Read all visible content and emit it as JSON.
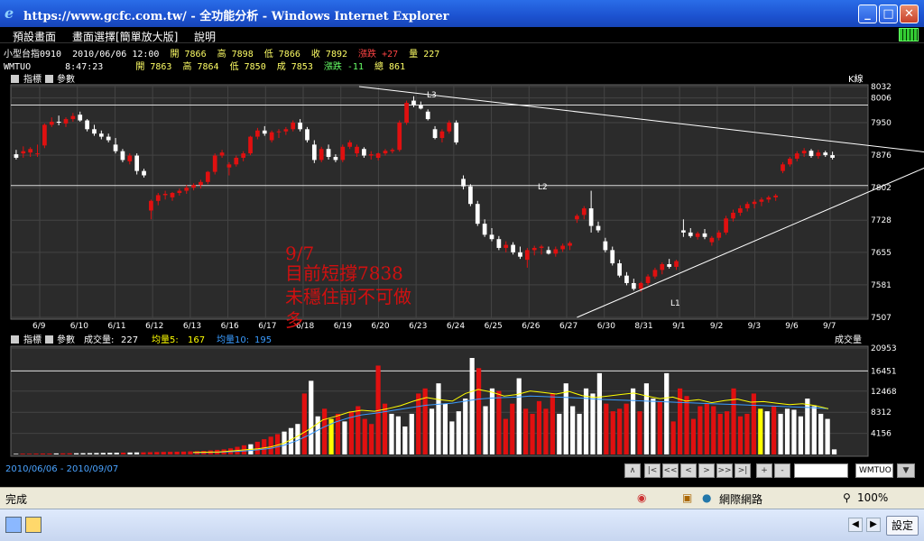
{
  "window": {
    "title": "https://www.gcfc.com.tw/ - 全功能分析 - Windows Internet Explorer",
    "buttons": [
      "_",
      "□",
      "✕"
    ]
  },
  "menu": {
    "items": [
      "預設畫面",
      "畫面選擇[簡單放大版]",
      "說明"
    ]
  },
  "quotes": {
    "row1": [
      "小型台指0910",
      "2010/06/06 12:00",
      "開 7866",
      "高 7898",
      "低 7866",
      "收 7892",
      "漲跌 +27",
      "量 227"
    ],
    "row2": [
      "WMTUO",
      "8:47:23",
      "開 7863",
      "高 7864",
      "低 7850",
      "成 7853",
      "漲跌 -11",
      "總 861"
    ]
  },
  "price_panel": {
    "indicator_label": "指標",
    "param_label": "參數",
    "kline_label": "K線",
    "y_ticks": [
      "8032",
      "8006",
      "7950",
      "7876",
      "7802",
      "7728",
      "7655",
      "7581",
      "7507"
    ],
    "x_ticks": [
      "6/9",
      "6/10",
      "6/11",
      "6/12",
      "6/13",
      "6/16",
      "6/17",
      "6/18",
      "6/19",
      "6/20",
      "6/23",
      "6/24",
      "6/25",
      "6/26",
      "6/27",
      "6/30",
      "8/31",
      "9/1",
      "9/2",
      "9/3",
      "9/6",
      "9/7"
    ],
    "marks": {
      "l1": "L1",
      "l2": "L2",
      "l3": "L3"
    },
    "annotation": {
      "line1": "9/7",
      "line2": "目前短撐7838",
      "line3": "未穩住前不可做",
      "line4": "多"
    }
  },
  "volume_panel": {
    "indicator_label": "指標",
    "param_label": "參數",
    "vol_label": "成交量:",
    "vol_value": "227",
    "ma5_label": "均量5:",
    "ma5_value": "167",
    "ma10_label": "均量10:",
    "ma10_value": "195",
    "right_label": "成交量",
    "y_ticks": [
      "20953",
      "16451",
      "12468",
      "8312",
      "4156"
    ]
  },
  "app_status": {
    "date_range": "2010/06/06 - 2010/09/07",
    "nav": [
      "∧",
      "|<",
      "<<",
      "<",
      ">",
      ">>",
      ">|",
      "+",
      "-"
    ],
    "symbol": "WMTUO"
  },
  "ie_status": {
    "done": "完成",
    "zone": "網際網路",
    "zoom": "100%"
  },
  "taskbar": {
    "settings": "設定"
  },
  "colors": {
    "up": "#e01010",
    "down": "#ffffff",
    "ma5": "#ffff00",
    "ma10": "#3a9bff",
    "panel_bg": "#2b2b2b"
  },
  "chart_data": {
    "type": "candlestick",
    "ylim": [
      7507,
      8032
    ],
    "candles": [
      [
        7878,
        7888,
        7866,
        7870
      ],
      [
        7880,
        7896,
        7870,
        7885
      ],
      [
        7882,
        7894,
        7872,
        7890
      ],
      [
        7878,
        7900,
        7872,
        7880
      ],
      [
        7898,
        7948,
        7892,
        7945
      ],
      [
        7945,
        7962,
        7940,
        7952
      ],
      [
        7952,
        7966,
        7944,
        7950
      ],
      [
        7948,
        7962,
        7940,
        7958
      ],
      [
        7958,
        7972,
        7952,
        7965
      ],
      [
        7968,
        7975,
        7952,
        7955
      ],
      [
        7955,
        7958,
        7930,
        7935
      ],
      [
        7935,
        7945,
        7920,
        7925
      ],
      [
        7925,
        7932,
        7912,
        7918
      ],
      [
        7918,
        7925,
        7905,
        7910
      ],
      [
        7900,
        7915,
        7880,
        7885
      ],
      [
        7885,
        7890,
        7860,
        7865
      ],
      [
        7862,
        7880,
        7855,
        7875
      ],
      [
        7875,
        7880,
        7832,
        7840
      ],
      [
        7840,
        7845,
        7825,
        7830
      ],
      [
        7750,
        7775,
        7730,
        7772
      ],
      [
        7772,
        7790,
        7762,
        7785
      ],
      [
        7785,
        7795,
        7775,
        7788
      ],
      [
        7780,
        7792,
        7772,
        7790
      ],
      [
        7790,
        7800,
        7784,
        7795
      ],
      [
        7795,
        7808,
        7788,
        7802
      ],
      [
        7802,
        7812,
        7796,
        7808
      ],
      [
        7808,
        7820,
        7800,
        7815
      ],
      [
        7815,
        7840,
        7810,
        7838
      ],
      [
        7838,
        7880,
        7832,
        7875
      ],
      [
        7875,
        7888,
        7870,
        7882
      ],
      [
        7848,
        7860,
        7830,
        7855
      ],
      [
        7855,
        7875,
        7850,
        7870
      ],
      [
        7870,
        7885,
        7862,
        7880
      ],
      [
        7880,
        7920,
        7876,
        7918
      ],
      [
        7918,
        7938,
        7912,
        7932
      ],
      [
        7932,
        7942,
        7920,
        7925
      ],
      [
        7910,
        7932,
        7905,
        7928
      ],
      [
        7928,
        7935,
        7915,
        7930
      ],
      [
        7930,
        7940,
        7922,
        7935
      ],
      [
        7935,
        7955,
        7930,
        7950
      ],
      [
        7950,
        7958,
        7930,
        7935
      ],
      [
        7935,
        7940,
        7905,
        7910
      ],
      [
        7900,
        7910,
        7858,
        7865
      ],
      [
        7865,
        7895,
        7860,
        7890
      ],
      [
        7890,
        7900,
        7866,
        7872
      ],
      [
        7872,
        7878,
        7860,
        7865
      ],
      [
        7865,
        7900,
        7860,
        7895
      ],
      [
        7895,
        7910,
        7890,
        7905
      ],
      [
        7880,
        7900,
        7872,
        7895
      ],
      [
        7890,
        7894,
        7870,
        7875
      ],
      [
        7875,
        7885,
        7866,
        7878
      ],
      [
        7870,
        7882,
        7864,
        7880
      ],
      [
        7880,
        7890,
        7875,
        7886
      ],
      [
        7885,
        7892,
        7880,
        7888
      ],
      [
        7888,
        7955,
        7884,
        7950
      ],
      [
        7950,
        8000,
        7945,
        7995
      ],
      [
        8000,
        8010,
        7985,
        7990
      ],
      [
        7990,
        7998,
        7980,
        7982
      ],
      [
        7975,
        7980,
        7955,
        7958
      ],
      [
        7935,
        7942,
        7912,
        7915
      ],
      [
        7915,
        7935,
        7905,
        7930
      ],
      [
        7930,
        7955,
        7925,
        7950
      ],
      [
        7950,
        7955,
        7900,
        7905
      ],
      [
        7822,
        7830,
        7798,
        7805
      ],
      [
        7805,
        7810,
        7760,
        7765
      ],
      [
        7765,
        7772,
        7715,
        7720
      ],
      [
        7720,
        7730,
        7690,
        7695
      ],
      [
        7695,
        7710,
        7680,
        7685
      ],
      [
        7685,
        7692,
        7660,
        7665
      ],
      [
        7665,
        7680,
        7655,
        7672
      ],
      [
        7672,
        7678,
        7650,
        7655
      ],
      [
        7655,
        7668,
        7640,
        7645
      ],
      [
        7638,
        7665,
        7620,
        7660
      ],
      [
        7660,
        7670,
        7648,
        7665
      ],
      [
        7665,
        7672,
        7650,
        7668
      ],
      [
        7660,
        7668,
        7650,
        7652
      ],
      [
        7652,
        7668,
        7645,
        7662
      ],
      [
        7662,
        7675,
        7656,
        7670
      ],
      [
        7670,
        7680,
        7660,
        7676
      ],
      [
        7730,
        7742,
        7722,
        7738
      ],
      [
        7740,
        7760,
        7730,
        7755
      ],
      [
        7755,
        7795,
        7700,
        7715
      ],
      [
        7715,
        7725,
        7700,
        7705
      ],
      [
        7680,
        7688,
        7655,
        7660
      ],
      [
        7660,
        7668,
        7625,
        7630
      ],
      [
        7630,
        7638,
        7598,
        7602
      ],
      [
        7602,
        7610,
        7580,
        7585
      ],
      [
        7585,
        7595,
        7568,
        7572
      ],
      [
        7572,
        7588,
        7565,
        7585
      ],
      [
        7585,
        7605,
        7580,
        7600
      ],
      [
        7600,
        7620,
        7595,
        7615
      ],
      [
        7615,
        7632,
        7605,
        7628
      ],
      [
        7628,
        7640,
        7618,
        7622
      ],
      [
        7622,
        7638,
        7615,
        7635
      ],
      [
        7705,
        7730,
        7690,
        7700
      ],
      [
        7700,
        7710,
        7688,
        7692
      ],
      [
        7690,
        7702,
        7684,
        7698
      ],
      [
        7698,
        7708,
        7685,
        7690
      ],
      [
        7678,
        7692,
        7670,
        7688
      ],
      [
        7688,
        7705,
        7682,
        7700
      ],
      [
        7700,
        7738,
        7695,
        7732
      ],
      [
        7732,
        7752,
        7725,
        7745
      ],
      [
        7745,
        7762,
        7738,
        7755
      ],
      [
        7755,
        7770,
        7748,
        7765
      ],
      [
        7765,
        7775,
        7755,
        7770
      ],
      [
        7770,
        7780,
        7760,
        7775
      ],
      [
        7775,
        7784,
        7768,
        7780
      ],
      [
        7780,
        7788,
        7772,
        7784
      ],
      [
        7840,
        7860,
        7835,
        7855
      ],
      [
        7855,
        7872,
        7850,
        7868
      ],
      [
        7868,
        7885,
        7862,
        7880
      ],
      [
        7880,
        7892,
        7872,
        7886
      ],
      [
        7886,
        7890,
        7870,
        7874
      ],
      [
        7874,
        7888,
        7868,
        7882
      ],
      [
        7882,
        7886,
        7872,
        7876
      ],
      [
        7876,
        7884,
        7866,
        7870
      ]
    ],
    "trendlines": [
      {
        "from": [
          0,
          8032
        ],
        "to": [
          134,
          7872
        ]
      },
      {
        "from": [
          79,
          7507
        ],
        "to": [
          134,
          7889
        ]
      }
    ],
    "hlines": [
      7990,
      7807
    ],
    "volume": {
      "ylim": [
        0,
        20953
      ],
      "values": [
        120,
        150,
        140,
        160,
        180,
        170,
        200,
        210,
        220,
        230,
        250,
        260,
        280,
        300,
        320,
        340,
        360,
        380,
        400,
        420,
        450,
        480,
        500,
        520,
        540,
        560,
        600,
        650,
        700,
        800,
        900,
        1000,
        1200,
        1500,
        1800,
        2000,
        2500,
        3000,
        3500,
        4000,
        4500,
        5200,
        6000,
        12000,
        14500,
        7500,
        9000,
        7000,
        8000,
        6500,
        8500,
        9500,
        7000,
        6000,
        17500,
        10000,
        8000,
        7500,
        5500,
        8000,
        12000,
        13000,
        9000,
        14000,
        10000,
        6500,
        8500,
        11000,
        19000,
        17000,
        9500,
        13000,
        12500,
        7000,
        10000,
        15000,
        9000,
        8000,
        10500,
        9000,
        12000,
        8000,
        14000,
        9500,
        8000,
        13000,
        12000,
        16000,
        10000,
        8500,
        9000,
        10000,
        13000,
        8500,
        14000,
        11000,
        10500,
        16000,
        6500,
        13000,
        11500,
        7000,
        9500,
        10000,
        9500,
        8000,
        8500,
        13000,
        7500,
        8000,
        12000,
        9000,
        8500,
        9500,
        8000,
        9000,
        8800,
        7500,
        11000,
        9500,
        8000,
        7000,
        1000
      ],
      "yellow_bars": [
        47,
        111
      ],
      "ma5": [
        400,
        450,
        500,
        700,
        900,
        1100,
        1500,
        2200,
        3500,
        5000,
        6800,
        7500,
        8300,
        8700,
        8500,
        9000,
        9600,
        10500,
        11200,
        10800,
        10500,
        12000,
        12800,
        12300,
        11500,
        11800,
        12500,
        12200,
        11900,
        12400,
        11600,
        11200,
        11500,
        11800,
        12100,
        11500,
        11000,
        11300,
        10500,
        10800,
        10200,
        10600,
        10900,
        10300,
        10400,
        10100,
        9800,
        10000,
        9600,
        9000
      ],
      "ma10": [
        350,
        400,
        450,
        550,
        700,
        900,
        1200,
        1800,
        2700,
        3900,
        5300,
        6400,
        7200,
        7800,
        8100,
        8500,
        8900,
        9300,
        9700,
        9900,
        10100,
        10500,
        10900,
        11100,
        11200,
        11300,
        11500,
        11400,
        11300,
        11200,
        11100,
        10900,
        10800,
        10700,
        10600,
        10500,
        10400,
        10300,
        10200,
        10100,
        10000,
        9900,
        9800,
        9700,
        9600,
        9500,
        9400,
        9300,
        9200,
        9000
      ]
    }
  }
}
